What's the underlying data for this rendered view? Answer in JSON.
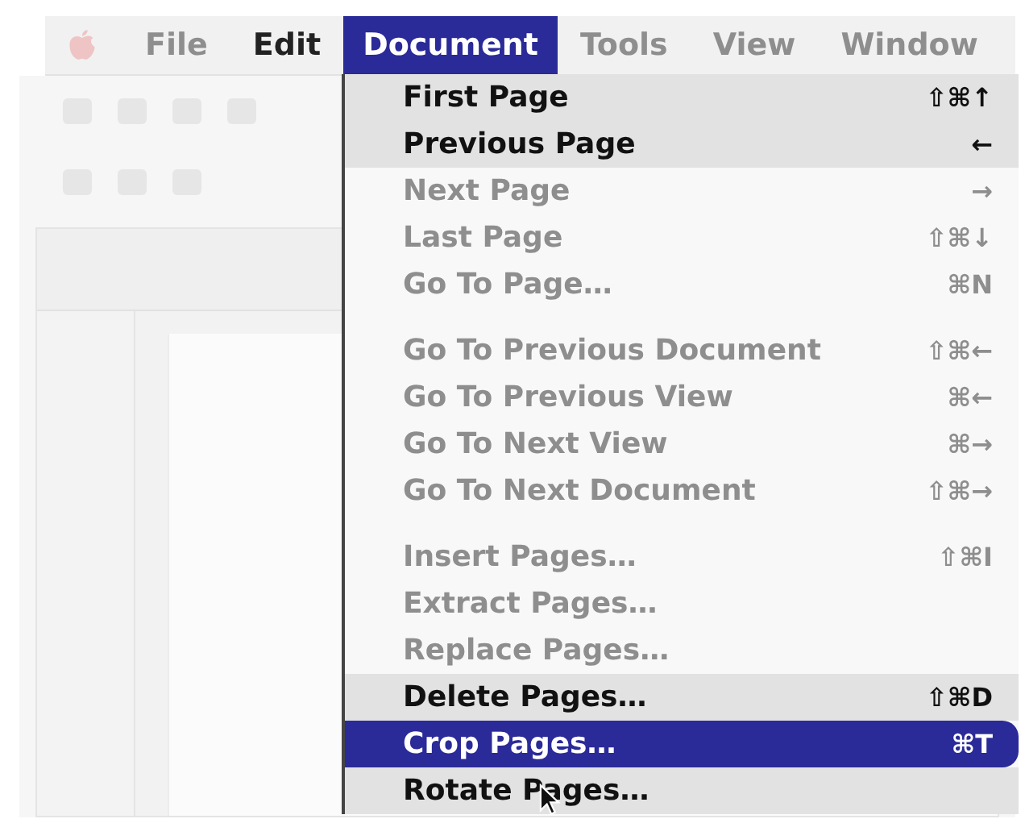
{
  "menu_bar": [
    {
      "kind": "apple"
    },
    {
      "kind": "title",
      "label": "File",
      "selected": false,
      "in_focus": false
    },
    {
      "kind": "title",
      "label": "Edit",
      "selected": false,
      "in_focus": true
    },
    {
      "kind": "title",
      "label": "Document",
      "selected": true,
      "in_focus": true
    },
    {
      "kind": "title",
      "label": "Tools",
      "selected": false,
      "in_focus": false
    },
    {
      "kind": "title",
      "label": "View",
      "selected": false,
      "in_focus": false
    },
    {
      "kind": "title",
      "label": "Window",
      "selected": false,
      "in_focus": false
    }
  ],
  "menu": {
    "items": [
      {
        "kind": "item",
        "label": "First Page",
        "shortcut": "⇧⌘↑",
        "in_focus": true,
        "selected": false
      },
      {
        "kind": "item",
        "label": "Previous Page",
        "shortcut": "←",
        "in_focus": true,
        "selected": false
      },
      {
        "kind": "item",
        "label": "Next Page",
        "shortcut": "→",
        "in_focus": false,
        "selected": false
      },
      {
        "kind": "item",
        "label": "Last Page",
        "shortcut": "⇧⌘↓",
        "in_focus": false,
        "selected": false
      },
      {
        "kind": "item",
        "label": "Go To Page…",
        "shortcut": "⌘N",
        "in_focus": false,
        "selected": false
      },
      {
        "kind": "separator"
      },
      {
        "kind": "item",
        "label": "Go To Previous Document",
        "shortcut": "⇧⌘←",
        "in_focus": false,
        "selected": false
      },
      {
        "kind": "item",
        "label": "Go To Previous View",
        "shortcut": "⌘←",
        "in_focus": false,
        "selected": false
      },
      {
        "kind": "item",
        "label": "Go To Next View",
        "shortcut": "⌘→",
        "in_focus": false,
        "selected": false
      },
      {
        "kind": "item",
        "label": "Go To Next Document",
        "shortcut": "⇧⌘→",
        "in_focus": false,
        "selected": false
      },
      {
        "kind": "separator"
      },
      {
        "kind": "item",
        "label": "Insert Pages…",
        "shortcut": "⇧⌘I",
        "in_focus": false,
        "selected": false
      },
      {
        "kind": "item",
        "label": "Extract Pages…",
        "in_focus": false,
        "selected": false
      },
      {
        "kind": "item",
        "label": "Replace Pages…",
        "in_focus": false,
        "selected": false
      },
      {
        "kind": "item",
        "label": "Delete Pages…",
        "shortcut": "⇧⌘D",
        "in_focus": true,
        "selected": false
      },
      {
        "kind": "item",
        "label": "Crop Pages…",
        "shortcut": "⌘T",
        "in_focus": true,
        "selected": true
      },
      {
        "kind": "item",
        "label": "Rotate Pages…",
        "in_focus": true,
        "selected": false
      }
    ]
  }
}
